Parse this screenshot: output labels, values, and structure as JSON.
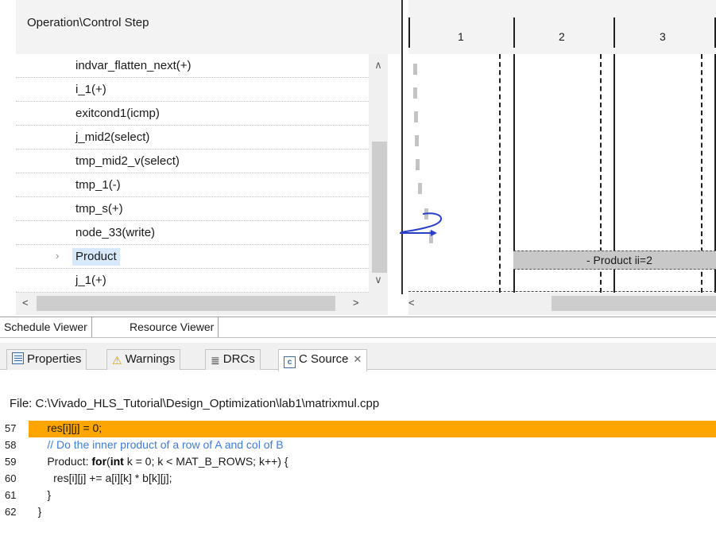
{
  "schedule": {
    "header_left": "Operation\\Control Step",
    "columns": [
      "1",
      "2",
      "3"
    ],
    "operations": [
      {
        "label": "indvar_flatten_next(+)",
        "expandable": false,
        "selected": false
      },
      {
        "label": "i_1(+)",
        "expandable": false,
        "selected": false
      },
      {
        "label": "exitcond1(icmp)",
        "expandable": false,
        "selected": false
      },
      {
        "label": "j_mid2(select)",
        "expandable": false,
        "selected": false
      },
      {
        "label": "tmp_mid2_v(select)",
        "expandable": false,
        "selected": false
      },
      {
        "label": "tmp_1(-)",
        "expandable": false,
        "selected": false
      },
      {
        "label": "tmp_s(+)",
        "expandable": false,
        "selected": false
      },
      {
        "label": "node_33(write)",
        "expandable": false,
        "selected": false
      },
      {
        "label": "Product",
        "expandable": true,
        "selected": true
      },
      {
        "label": "j_1(+)",
        "expandable": false,
        "selected": false
      }
    ],
    "product_bar_label": "- Product  ii=2",
    "tabs": [
      "Schedule Viewer",
      "Resource Viewer"
    ]
  },
  "icons": {
    "scroll_up": "▲-icon",
    "scroll_down": "▼-icon",
    "scroll_left": "◄-icon",
    "scroll_right": "►-icon",
    "expand": "chevron-right-icon"
  },
  "lower_tabs": {
    "properties": "Properties",
    "warnings": "Warnings",
    "drcs": "DRCs",
    "csource": "C Source"
  },
  "source": {
    "file_label": "File: C:\\Vivado_HLS_Tutorial\\Design_Optimization\\lab1\\matrixmul.cpp",
    "lines": [
      {
        "num": "57",
        "text": "      res[i][j] = 0;",
        "highlight": true
      },
      {
        "num": "58",
        "text": "      // Do the inner product of a row of A and col of B",
        "highlight": false
      },
      {
        "num": "59",
        "text": "      Product: for(int k = 0; k < MAT_B_ROWS; k++) {",
        "highlight": false
      },
      {
        "num": "60",
        "text": "        res[i][j] += a[i][k] * b[k][j];",
        "highlight": false
      },
      {
        "num": "61",
        "text": "      }",
        "highlight": false
      },
      {
        "num": "62",
        "text": "   }",
        "highlight": false
      }
    ]
  },
  "colors": {
    "highlight": "#ffa500",
    "comment": "#3d7cdf",
    "loop_arrow": "#2a3fc8"
  }
}
